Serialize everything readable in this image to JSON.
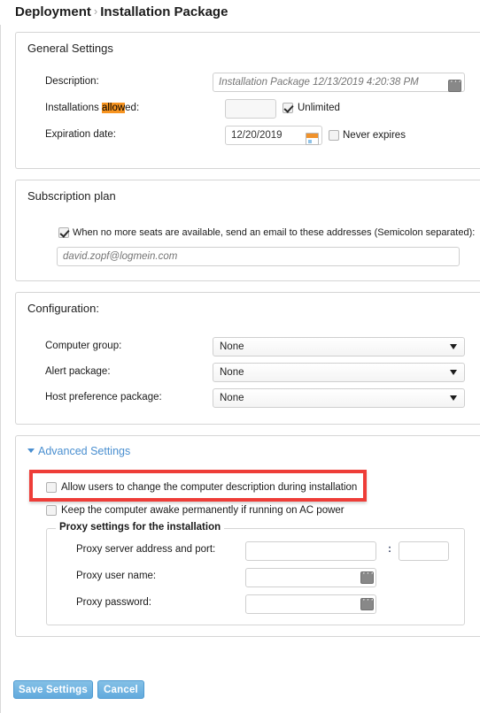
{
  "breadcrumb": {
    "root": "Deployment",
    "separator": "›",
    "current": "Installation Package"
  },
  "general_settings": {
    "title": "General Settings",
    "description": {
      "label": "Description:",
      "value": "",
      "placeholder": "Installation Package 12/13/2019 4:20:38 PM",
      "picker_icon": "ellipsis-picker-icon"
    },
    "installations_allowed": {
      "label_before": "Installations ",
      "label_highlight": "allow",
      "label_after": "ed:",
      "value": "",
      "unlimited_label": "Unlimited",
      "unlimited_checked": true
    },
    "expiration_date": {
      "label": "Expiration date:",
      "value": "12/20/2019",
      "calendar_icon": "calendar-icon",
      "never_expires_label": "Never expires",
      "never_expires_checked": false
    }
  },
  "subscription_plan": {
    "title": "Subscription plan",
    "notify_checked": true,
    "notify_label": "When no more seats are available, send an email to these addresses (Semicolon separated):",
    "email_value": "",
    "email_placeholder": "david.zopf@logmein.com"
  },
  "configuration": {
    "title": "Configuration:",
    "fields": [
      {
        "label": "Computer group:",
        "value": "None"
      },
      {
        "label": "Alert package:",
        "value": "None"
      },
      {
        "label": "Host preference package:",
        "value": "None"
      }
    ]
  },
  "advanced_settings": {
    "link_label": "Advanced Settings",
    "expanded": true,
    "allow_description_change": {
      "label": "Allow users to change the computer description during installation",
      "checked": false,
      "highlighted": true
    },
    "keep_awake": {
      "label": "Keep the computer awake permanently if running on AC power",
      "checked": false
    },
    "proxy": {
      "legend": "Proxy settings for the installation",
      "address_label": "Proxy server address and port:",
      "address_value": "",
      "port_separator": ":",
      "port_value": "",
      "user_label": "Proxy user name:",
      "user_value": "",
      "password_label": "Proxy password:",
      "password_value": "",
      "picker_icon": "ellipsis-picker-icon"
    }
  },
  "footer": {
    "save_label": "Save Settings",
    "cancel_label": "Cancel"
  },
  "colors": {
    "accent_blue": "#62aadd",
    "link_blue": "#4a8fd0",
    "highlight_orange": "#f79420",
    "annotation_red": "#ee3d38",
    "panel_border": "#d5d5d5"
  }
}
